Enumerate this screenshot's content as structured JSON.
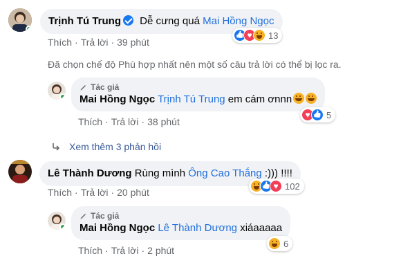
{
  "comments": [
    {
      "name": "Trịnh Tú Trung",
      "verified": true,
      "text": "Dễ cưng quá",
      "mention": "Mai Hồng Ngọc",
      "actions": {
        "like": "Thích",
        "reply": "Trả lời",
        "time": "39 phút"
      },
      "reaction_count": "13"
    },
    {
      "author_tag": "Tác giả",
      "name": "Mai Hồng Ngọc",
      "mention": "Trịnh Tú Trung",
      "text": "em cám ơnnn",
      "actions": {
        "like": "Thích",
        "reply": "Trả lời",
        "time": "38 phút"
      },
      "reaction_count": "5"
    },
    {
      "name": "Lê Thành Dương",
      "text": "Rùng mình",
      "mention": "Ông Cao Thắng",
      "text_after": ":))) !!!!",
      "actions": {
        "like": "Thích",
        "reply": "Trả lời",
        "time": "20 phút"
      },
      "reaction_count": "102"
    },
    {
      "author_tag": "Tác giả",
      "name": "Mai Hồng Ngọc",
      "mention": "Lê Thành Dương",
      "text": "xiáaaaaa",
      "actions": {
        "like": "Thích",
        "reply": "Trả lời",
        "time": "2 phút"
      },
      "reaction_count": "6"
    }
  ],
  "filter_note": "Đã chọn chế độ Phù hợp nhất nên một số câu trả lời có thể bị lọc ra.",
  "see_more": "Xem thêm 3 phản hồi",
  "colors": {
    "link": "#216fdb",
    "meta": "#65676b",
    "bubble": "#f0f2f5",
    "online": "#31a24c"
  }
}
